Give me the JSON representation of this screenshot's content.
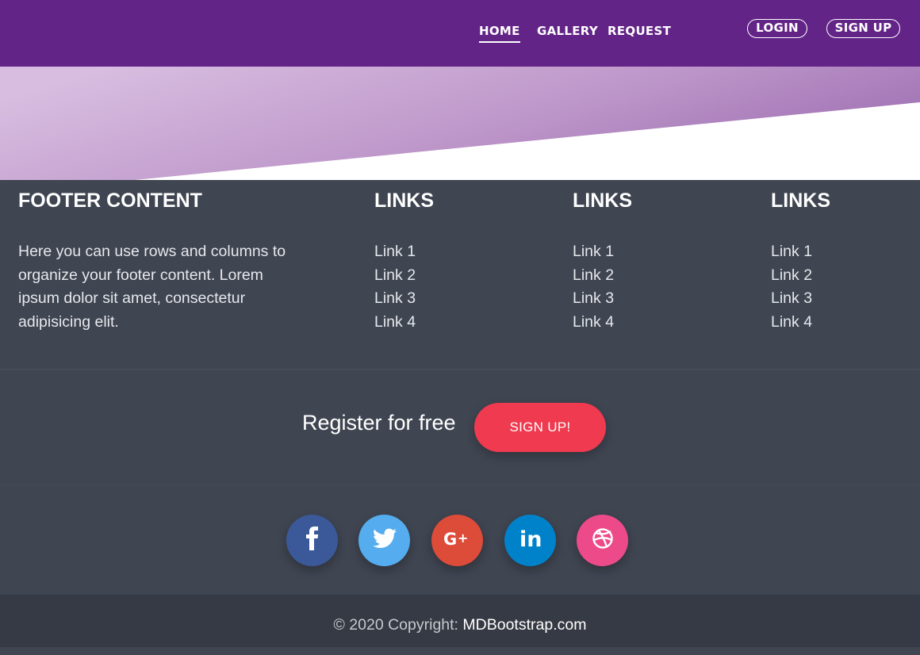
{
  "navbar": {
    "links": [
      "HOME",
      "GALLERY",
      "REQUEST"
    ],
    "login_label": "LOGIN",
    "signup_label": "SIGN UP"
  },
  "footer": {
    "content_title": "FOOTER CONTENT",
    "content_text": "Here you can use rows and columns to organize your footer content. Lorem ipsum dolor sit amet, consectetur adipisicing elit.",
    "link_columns": [
      {
        "title": "LINKS",
        "links": [
          "Link 1",
          "Link 2",
          "Link 3",
          "Link 4"
        ]
      },
      {
        "title": "LINKS",
        "links": [
          "Link 1",
          "Link 2",
          "Link 3",
          "Link 4"
        ]
      },
      {
        "title": "LINKS",
        "links": [
          "Link 1",
          "Link 2",
          "Link 3",
          "Link 4"
        ]
      }
    ],
    "register_text": "Register for free",
    "register_button": "SIGN UP!",
    "social": [
      {
        "icon": "facebook-icon",
        "color": "#3b5998"
      },
      {
        "icon": "twitter-icon",
        "color": "#55acee"
      },
      {
        "icon": "google-plus-icon",
        "color": "#dd4b39"
      },
      {
        "icon": "linkedin-icon",
        "color": "#0082ca"
      },
      {
        "icon": "dribbble-icon",
        "color": "#ec4a89"
      }
    ],
    "copyright_prefix": "© 2020 Copyright:",
    "copyright_link": "MDBootstrap.com"
  },
  "colors": {
    "navbar": "#632487",
    "footer": "#3f4551",
    "copyright_bar": "#363a44",
    "cta": "#ef3a4f"
  }
}
